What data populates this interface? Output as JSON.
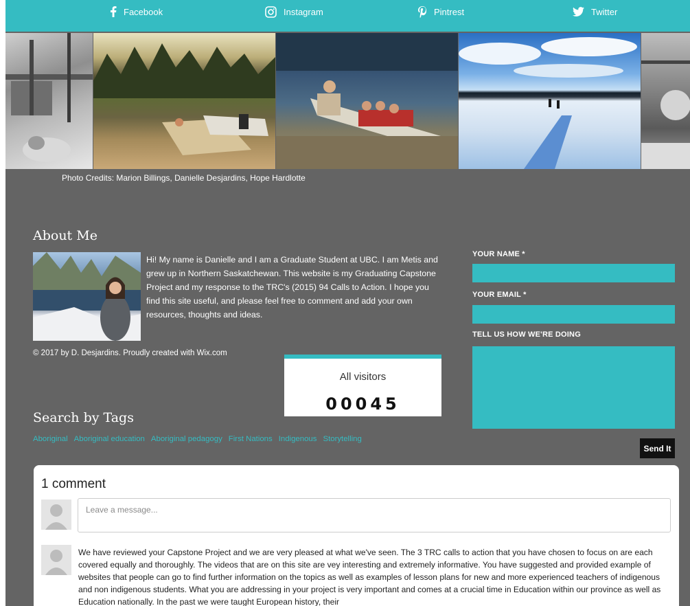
{
  "social": {
    "facebook": "Facebook",
    "instagram": "Instagram",
    "pinterest": "Pintrest",
    "twitter": "Twitter"
  },
  "credits": "Photo Credits: Marion Billings, Danielle Desjardins, Hope Hardlotte",
  "about": {
    "title": "About Me",
    "text": "Hi! My name is Danielle and I am a Graduate Student at UBC.  I am Metis and grew up in Northern Saskatchewan. This website is my Graduating Capstone Project and my response to the TRC's (2015) 94 Calls to Action.  I hope you find this site useful, and please feel free to comment and add your own resources, thoughts and ideas.",
    "copyright": "© 2017 by D. Desjardins.  Proudly created with Wix.com"
  },
  "counter": {
    "label": "All visitors",
    "value": "00045"
  },
  "tags": {
    "title": "Search by Tags",
    "items": [
      "Aboriginal",
      "Aboriginal education",
      "Aboriginal pedagogy",
      "First Nations",
      "Indigenous",
      "Storytelling"
    ]
  },
  "form": {
    "name_label": "YOUR NAME *",
    "email_label": "YOUR EMAIL *",
    "feedback_label": "TELL US HOW WE'RE DOING",
    "send_label": "Send It"
  },
  "comments": {
    "count_label": "1 comment",
    "input_placeholder": "Leave a message...",
    "first_comment": "We have reviewed your Capstone Project and we are very pleased at what we've seen. The 3 TRC calls to action that you have chosen to focus on are each covered equally and thoroughly. The videos that are on this site are vey interesting and extremely informative. You have suggested and provided example of websites that people can go to find further information on the topics as well as examples of lesson plans for new and more experienced teachers of indigenous and non indigenous students. What you are addressing in your project is very important and comes at a crucial time in Education within our province as well as Education nationally. In the past we were taught European history, their"
  },
  "colors": {
    "accent": "#35bcc2",
    "background": "#646464",
    "button": "#111111"
  }
}
